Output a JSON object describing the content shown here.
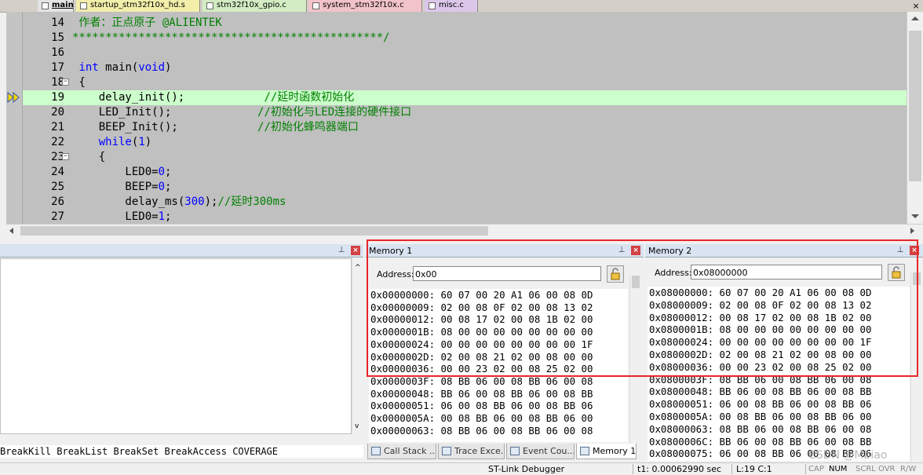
{
  "tabs": [
    {
      "label": "main.c",
      "active": true,
      "color": "#e3e3e3"
    },
    {
      "label": "startup_stm32f10x_hd.s",
      "active": false,
      "color": "#f3eeaa"
    },
    {
      "label": "stm32f10x_gpio.c",
      "active": false,
      "color": "#d3ecc3"
    },
    {
      "label": "system_stm32f10x.c",
      "active": false,
      "color": "#f2c3c9"
    },
    {
      "label": "misc.c",
      "active": false,
      "color": "#dcc7ea"
    }
  ],
  "editor": {
    "lines": [
      {
        "num": "14",
        "parts": [
          {
            "t": " 作者：正点原子 @ALIENTEK",
            "c": "cm"
          }
        ]
      },
      {
        "num": "15",
        "parts": [
          {
            "t": "***********************************************/",
            "c": "cm"
          }
        ]
      },
      {
        "num": "16",
        "parts": []
      },
      {
        "num": "17",
        "parts": [
          {
            "t": " ",
            "c": ""
          },
          {
            "t": "int",
            "c": "kw"
          },
          {
            "t": " main(",
            "c": ""
          },
          {
            "t": "void",
            "c": "kw"
          },
          {
            "t": ")",
            "c": ""
          }
        ]
      },
      {
        "num": "18",
        "fold": "−",
        "parts": [
          {
            "t": " {",
            "c": ""
          }
        ]
      },
      {
        "num": "19",
        "current": true,
        "parts": [
          {
            "t": "    delay_init();            ",
            "c": ""
          },
          {
            "t": "//延时函数初始化",
            "c": "cm"
          }
        ]
      },
      {
        "num": "20",
        "parts": [
          {
            "t": "    LED_Init();             ",
            "c": ""
          },
          {
            "t": "//初始化与LED连接的硬件接口",
            "c": "cm"
          }
        ]
      },
      {
        "num": "21",
        "parts": [
          {
            "t": "    BEEP_Init();            ",
            "c": ""
          },
          {
            "t": "//初始化蜂鸣器端口",
            "c": "cm"
          }
        ]
      },
      {
        "num": "22",
        "parts": [
          {
            "t": "    ",
            "c": ""
          },
          {
            "t": "while",
            "c": "kw"
          },
          {
            "t": "(",
            "c": ""
          },
          {
            "t": "1",
            "c": "num"
          },
          {
            "t": ")",
            "c": ""
          }
        ]
      },
      {
        "num": "23",
        "fold": "−",
        "parts": [
          {
            "t": "    {",
            "c": ""
          }
        ]
      },
      {
        "num": "24",
        "parts": [
          {
            "t": "        LED0=",
            "c": ""
          },
          {
            "t": "0",
            "c": "num"
          },
          {
            "t": ";",
            "c": ""
          }
        ]
      },
      {
        "num": "25",
        "parts": [
          {
            "t": "        BEEP=",
            "c": ""
          },
          {
            "t": "0",
            "c": "num"
          },
          {
            "t": ";",
            "c": ""
          }
        ]
      },
      {
        "num": "26",
        "parts": [
          {
            "t": "        delay_ms(",
            "c": ""
          },
          {
            "t": "300",
            "c": "num"
          },
          {
            "t": ");",
            "c": ""
          },
          {
            "t": "//延时300ms",
            "c": "cm"
          }
        ]
      },
      {
        "num": "27",
        "parts": [
          {
            "t": "        LED0=",
            "c": ""
          },
          {
            "t": "1",
            "c": "num"
          },
          {
            "t": ";",
            "c": ""
          }
        ]
      }
    ]
  },
  "command_pane": {
    "text": "BreakKill BreakList BreakSet BreakAccess COVERAGE"
  },
  "memory1": {
    "title": "Memory 1",
    "address_label": "Address:",
    "address_value": "0x00",
    "rows": [
      "0x00000000: 60 07 00 20 A1 06 00 08 0D",
      "0x00000009: 02 00 08 0F 02 00 08 13 02",
      "0x00000012: 00 08 17 02 00 08 1B 02 00",
      "0x0000001B: 08 00 00 00 00 00 00 00 00",
      "0x00000024: 00 00 00 00 00 00 00 00 1F",
      "0x0000002D: 02 00 08 21 02 00 08 00 00",
      "0x00000036: 00 00 23 02 00 08 25 02 00",
      "0x0000003F: 08 BB 06 00 08 BB 06 00 08",
      "0x00000048: BB 06 00 08 BB 06 00 08 BB",
      "0x00000051: 06 00 08 BB 06 00 08 BB 06",
      "0x0000005A: 00 08 BB 06 00 08 BB 06 00",
      "0x00000063: 08 BB 06 00 08 BB 06 00 08"
    ]
  },
  "memory2": {
    "title": "Memory 2",
    "address_label": "Address:",
    "address_value": "0x08000000",
    "rows": [
      "0x08000000: 60 07 00 20 A1 06 00 08 0D",
      "0x08000009: 02 00 08 0F 02 00 08 13 02",
      "0x08000012: 00 08 17 02 00 08 1B 02 00",
      "0x0800001B: 08 00 00 00 00 00 00 00 00",
      "0x08000024: 00 00 00 00 00 00 00 00 1F",
      "0x0800002D: 02 00 08 21 02 00 08 00 00",
      "0x08000036: 00 00 23 02 00 08 25 02 00",
      "0x0800003F: 08 BB 06 00 08 BB 06 00 08",
      "0x08000048: BB 06 00 08 BB 06 00 08 BB",
      "0x08000051: 06 00 08 BB 06 00 08 BB 06",
      "0x0800005A: 00 08 BB 06 00 08 BB 06 00",
      "0x08000063: 08 BB 06 00 08 BB 06 00 08",
      "0x0800006C: BB 06 00 08 BB 06 00 08 BB",
      "0x08000075: 06 00 08 BB 06 00 08 BB 06"
    ]
  },
  "bottom_tabs": [
    {
      "label": "Call Stack ...",
      "icon": "call-stack-icon",
      "active": false
    },
    {
      "label": "Trace Exce...",
      "icon": "trace-exceptions-icon",
      "active": false
    },
    {
      "label": "Event Cou...",
      "icon": "event-counters-icon",
      "active": false
    },
    {
      "label": "Memory 1",
      "icon": "memory-icon",
      "active": true
    }
  ],
  "status": {
    "debugger": "ST-Link Debugger",
    "time": "t1: 0.00062990 sec",
    "position": "L:19 C:1",
    "indicators": [
      "CAP",
      "NUM",
      "SCRL",
      "OVR",
      "R/W"
    ]
  },
  "watermark": "CSDN @Mbiao",
  "colors": {
    "highlight_box": "#e8262a",
    "current_line": "#ccffcc",
    "comment": "#008000",
    "keyword": "#0000ff"
  }
}
